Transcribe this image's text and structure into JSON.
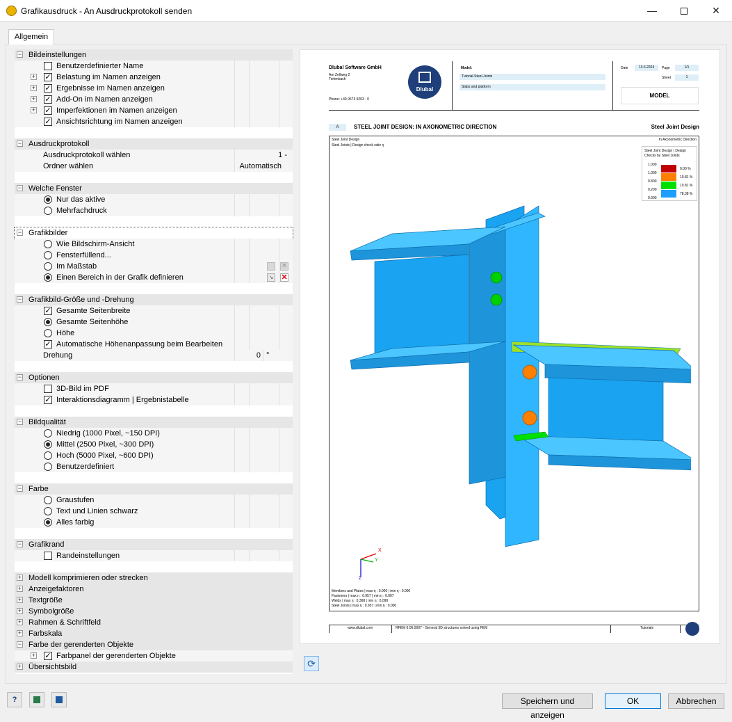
{
  "window": {
    "title": "Grafikausdruck - An Ausdruckprotokoll senden"
  },
  "tab": {
    "label": "Allgemein"
  },
  "tree": {
    "bildeinstellungen": {
      "header": "Bildeinstellungen",
      "items": [
        "Benutzerdefinierter Name",
        "Belastung im Namen anzeigen",
        "Ergebnisse im Namen anzeigen",
        "Add-On im Namen anzeigen",
        "Imperfektionen im Namen anzeigen",
        "Ansichtsrichtung im Namen anzeigen"
      ]
    },
    "ausdruckprotokoll": {
      "header": "Ausdruckprotokoll",
      "items": [
        {
          "label": "Ausdruckprotokoll wählen",
          "value": "1 -"
        },
        {
          "label": "Ordner wählen",
          "value": "Automatisch"
        }
      ]
    },
    "fenster": {
      "header": "Welche Fenster",
      "items": [
        "Nur das aktive",
        "Mehrfachdruck"
      ]
    },
    "grafikbilder": {
      "header": "Grafikbilder",
      "items": [
        "Wie Bildschirm-Ansicht",
        "Fensterfüllend...",
        "Im Maßstab",
        "Einen Bereich in der Grafik definieren"
      ]
    },
    "groesse": {
      "header": "Grafikbild-Größe und -Drehung",
      "items": [
        "Gesamte Seitenbreite",
        "Gesamte Seitenhöhe",
        "Höhe",
        "Automatische Höhenanpassung beim Bearbeiten"
      ],
      "rotation": {
        "label": "Drehung",
        "value": "0",
        "unit": "°"
      }
    },
    "optionen": {
      "header": "Optionen",
      "items": [
        "3D-Bild im PDF",
        "Interaktionsdiagramm | Ergebnistabelle"
      ]
    },
    "qualitaet": {
      "header": "Bildqualität",
      "items": [
        "Niedrig (1000 Pixel, ~150 DPI)",
        "Mittel (2500 Pixel, ~300 DPI)",
        "Hoch (5000 Pixel, ~600 DPI)",
        "Benutzerdefiniert"
      ]
    },
    "farbe": {
      "header": "Farbe",
      "items": [
        "Graustufen",
        "Text und Linien schwarz",
        "Alles farbig"
      ]
    },
    "rand": {
      "header": "Grafikrand",
      "items": [
        "Randeinstellungen"
      ]
    },
    "collapsed": [
      "Modell komprimieren oder strecken",
      "Anzeigefaktoren",
      "Textgröße",
      "Symbolgröße",
      "Rahmen & Schriftfeld",
      "Farbskala"
    ],
    "farbe_objekte": {
      "header": "Farbe der gerenderten Objekte",
      "items": [
        "Farbpanel der gerenderten Objekte"
      ]
    },
    "uebersicht": {
      "header": "Übersichtsbild"
    }
  },
  "preview": {
    "company": "Dlubal Software GmbH",
    "address1": "Am Zellweg 2",
    "address2": "Tiefenbach",
    "phone": "Phone: +49 9673 9203 - 0",
    "logo_text": "Dlubal",
    "model_label": "Model:",
    "model_name": "Tutorial-Steel-Joints",
    "model_desc": "Slabs and platform",
    "date_label": "Date",
    "date_value": "13.6.2024",
    "page_label": "Page",
    "page_value": "1/1",
    "sheet_label": "Sheet",
    "sheet_value": "1",
    "model_box": "MODEL",
    "section_marker": "A",
    "section_title": "STEEL JOINT DESIGN: IN AXONOMETRIC DIRECTION",
    "section_right": "Steel Joint Design",
    "sub1": "Steel Joint Design",
    "sub2": "Steel Joints | Design check ratio η",
    "sub_right": "In Axonometric Direction",
    "legend_title1": "Steel Joint Design | Design",
    "legend_title2": "Checks by Steel Joints",
    "legend_ticks": [
      "1.000",
      "1.000",
      "0.800",
      "0.200",
      "0.000"
    ],
    "legend": [
      {
        "color": "#c00000",
        "pct": "0.00 %"
      },
      {
        "color": "#ff8000",
        "pct": "10.81 %"
      },
      {
        "color": "#00e000",
        "pct": "10.81 %"
      },
      {
        "color": "#1e9fff",
        "pct": "78.38 %"
      }
    ],
    "summary": [
      "Members and Plates | max η : 0.000 | min η : 0.000",
      "Fasteners | max η : 0.957 | min η : 0.007",
      "Welds | max η : 0.368 | min η : 0.090",
      "Steel Joints | max η : 0.957 | min η : 0.000"
    ],
    "footer_web": "www.dlubal.com",
    "footer_soft": "RFEM 6.06.0007 - General 3D structures solved using FEM",
    "footer_right": "Tutorials",
    "axis_x": "X",
    "axis_y": "Y",
    "axis_z": "Z"
  },
  "buttons": {
    "save_show": "Speichern und anzeigen",
    "ok": "OK",
    "cancel": "Abbrechen"
  }
}
